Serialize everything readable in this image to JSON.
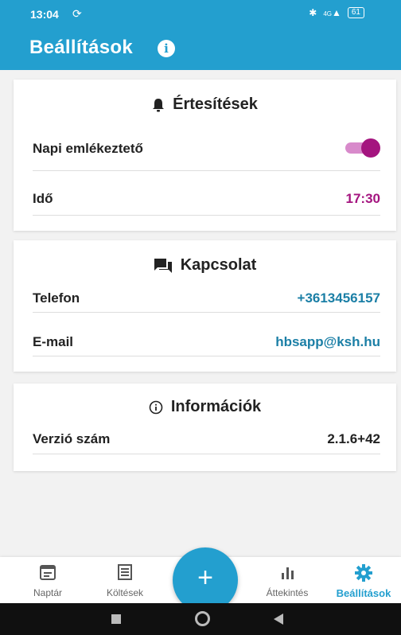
{
  "status_bar": {
    "time": "13:04",
    "signal": "4G",
    "battery": "61"
  },
  "app_bar": {
    "title": "Beállítások"
  },
  "notifications": {
    "heading": "Értesítések",
    "reminder_label": "Napi emlékeztető",
    "reminder_enabled": true,
    "time_label": "Idő",
    "time_value": "17:30"
  },
  "contact": {
    "heading": "Kapcsolat",
    "phone_label": "Telefon",
    "phone_value": "+3613456157",
    "email_label": "E-mail",
    "email_value": "hbsapp@ksh.hu"
  },
  "info": {
    "heading": "Információk",
    "version_label": "Verzió szám",
    "version_value": "2.1.6+42"
  },
  "bottom_nav": {
    "items": [
      {
        "label": "Naptár",
        "icon": "calendar-icon"
      },
      {
        "label": "Költések",
        "icon": "receipt-icon"
      },
      {
        "label": "Áttekintés",
        "icon": "bar-chart-icon"
      },
      {
        "label": "Beállítások",
        "icon": "gear-icon"
      }
    ],
    "fab_label": "+"
  },
  "colors": {
    "primary": "#239fcf",
    "accent": "#a4147f",
    "link": "#1b7fa6"
  }
}
